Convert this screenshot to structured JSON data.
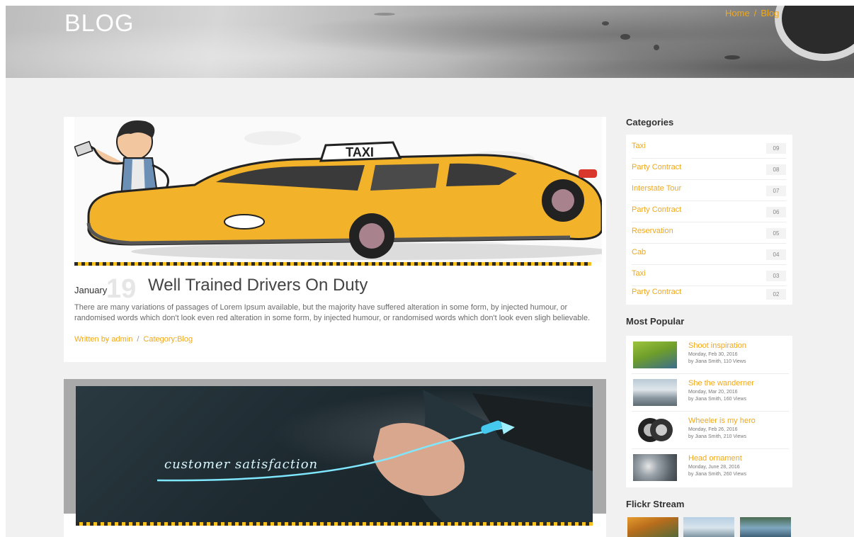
{
  "hero": {
    "title": "BLOG",
    "breadcrumb": {
      "home": "Home",
      "separator": "/",
      "current": "Blog"
    }
  },
  "posts": [
    {
      "date_day": "19",
      "date_month": "January",
      "title": "Well Trained Drivers On Duty",
      "excerpt": "There are many variations of passages of Lorem Ipsum available, but the majority have suffered alteration in some form, by injected humour, or randomised words which don't look even red alteration in some form, by injected humour, or randomised words which don't look even sligh believable.",
      "author": "Written by admin",
      "meta_separator": "/",
      "category": "Category:Blog",
      "taxi_sign": "TAXI"
    },
    {
      "image_caption": "customer satisfaction"
    }
  ],
  "sidebar": {
    "categories_title": "Categories",
    "categories": [
      {
        "label": "Taxi",
        "count": "09"
      },
      {
        "label": "Party Contract",
        "count": "08"
      },
      {
        "label": "Interstate Tour",
        "count": "07"
      },
      {
        "label": "Party Contract",
        "count": "06"
      },
      {
        "label": "Reservation",
        "count": "05"
      },
      {
        "label": "Cab",
        "count": "04"
      },
      {
        "label": "Taxi",
        "count": "03"
      },
      {
        "label": "Party Contract",
        "count": "02"
      }
    ],
    "popular_title": "Most Popular",
    "popular": [
      {
        "title": "Shoot inspiration",
        "date": "Monday, Feb 30, 2016",
        "by": "by Jiana Smith, 110 Views"
      },
      {
        "title": "She the wanderner",
        "date": "Monday, Mar 20, 2016",
        "by": "by Jiana Smith, 160 Views"
      },
      {
        "title": "Wheeler is my hero",
        "date": "Monday, Feb 26, 2016",
        "by": "by Jiana Smith, 210 Views"
      },
      {
        "title": "Head ornament",
        "date": "Monday, June 28, 2016",
        "by": "by Jiana Smith, 260 Views"
      }
    ],
    "flickr_title": "Flickr Stream"
  },
  "colors": {
    "accent": "#f0a81c",
    "page_bg": "#f1f1f1",
    "card_bg": "#ffffff",
    "heading": "#444444"
  }
}
